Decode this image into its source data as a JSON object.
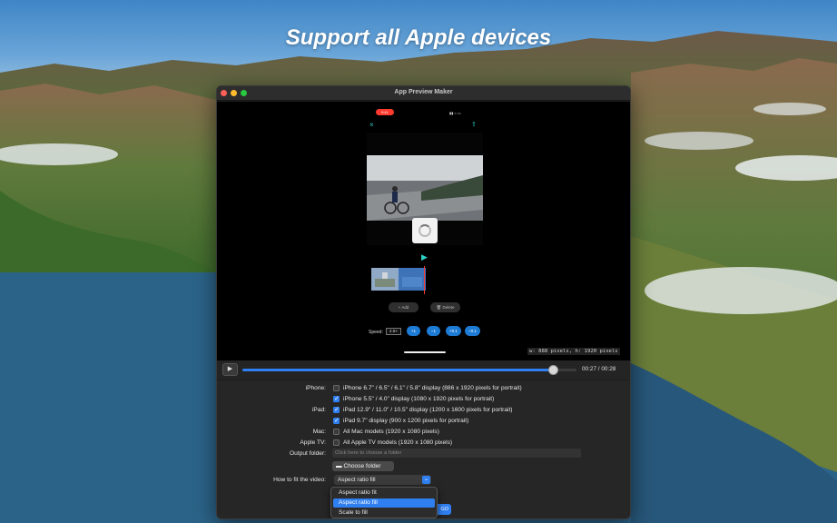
{
  "headline": "Support all Apple devices",
  "window": {
    "title": "App Preview Maker"
  },
  "preview": {
    "rec_badge": "9:41",
    "status_icons": "▮▮ ≈ ▭",
    "close_icon": "×",
    "share_icon": "⇪",
    "play_icon": "▶",
    "add_label": "+ Add",
    "delete_label": "🗑 Delete",
    "speed_label": "Speed:",
    "speed_value": "2.5×",
    "speed_buttons": [
      "+1",
      "−1",
      "+0.1",
      "−0.1"
    ],
    "dimensions": "w: 888 pixels, h: 1920 pixels"
  },
  "timeline": {
    "play_icon": "▶",
    "time": "00:27 / 00:28",
    "progress": 0.93
  },
  "settings": {
    "iphone_label": "iPhone:",
    "iphone_options": [
      {
        "text": "iPhone 6.7\" / 6.5\" / 6.1\" / 5.8\" display (886 x 1920 pixels for portrait)",
        "checked": false
      },
      {
        "text": "iPhone 5.5\" / 4.0\" display (1080 x 1920 pixels for portrait)",
        "checked": true
      }
    ],
    "ipad_label": "iPad:",
    "ipad_options": [
      {
        "text": "iPad 12.9\" / 11.0\" / 10.5\" display (1200 x 1600 pixels for portrait)",
        "checked": true
      },
      {
        "text": "iPad 9.7\" display (900 x 1200 pixels for portrait)",
        "checked": true
      }
    ],
    "mac_label": "Mac:",
    "mac_option": {
      "text": "All Mac models (1920 x 1080 pixels)",
      "checked": false
    },
    "tv_label": "Apple TV:",
    "tv_option": {
      "text": "All Apple TV models (1920 x 1080 pixels)",
      "checked": false
    },
    "output_label": "Output folder:",
    "output_placeholder": "Click here to choose a folder",
    "choose_folder_label": "Choose folder",
    "fit_label": "How to fit the video:",
    "fit_selected": "Aspect ratio fill",
    "fit_options": [
      "Aspect ratio fit",
      "Aspect ratio fill",
      "Scale to fill"
    ],
    "go_label": "GO"
  }
}
